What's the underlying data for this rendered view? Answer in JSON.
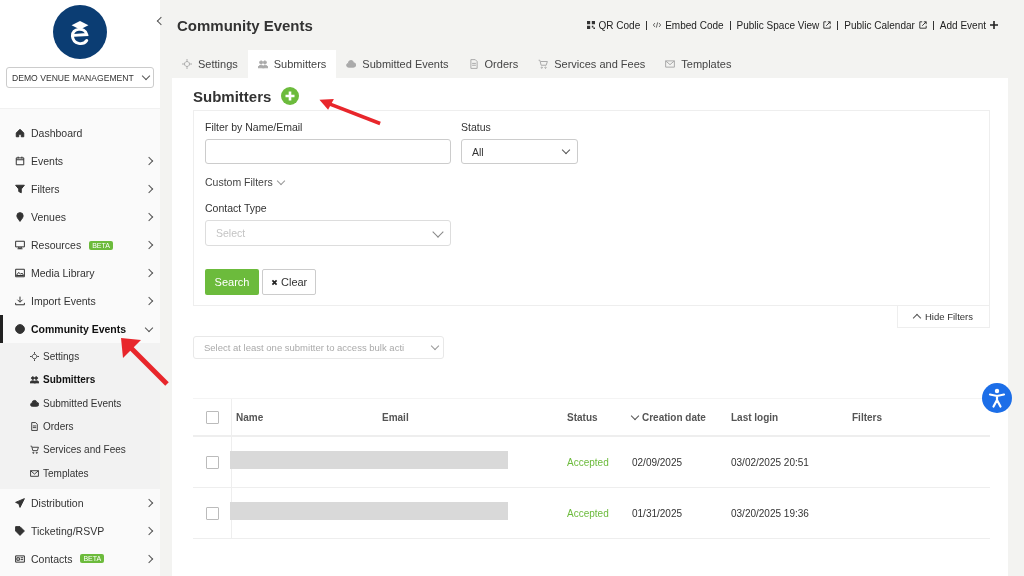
{
  "sidebar": {
    "venue_select": "DEMO VENUE MANAGEMENT",
    "items": [
      {
        "label": "Dashboard",
        "selected": false
      },
      {
        "label": "Events",
        "selected": false,
        "expanded": false
      },
      {
        "label": "Filters",
        "selected": false,
        "expanded": false
      },
      {
        "label": "Venues",
        "selected": false,
        "expanded": false
      },
      {
        "label": "Resources",
        "badge": "BETA",
        "selected": false,
        "expanded": false
      },
      {
        "label": "Media Library",
        "selected": false,
        "expanded": false
      },
      {
        "label": "Import Events",
        "selected": false,
        "expanded": false
      },
      {
        "label": "Community Events",
        "selected": true,
        "expanded": true,
        "children": [
          {
            "label": "Settings",
            "selected": false
          },
          {
            "label": "Submitters",
            "selected": true
          },
          {
            "label": "Submitted Events",
            "selected": false
          },
          {
            "label": "Orders",
            "selected": false
          },
          {
            "label": "Services and Fees",
            "selected": false
          },
          {
            "label": "Templates",
            "selected": false
          }
        ]
      },
      {
        "label": "Distribution",
        "selected": false,
        "expanded": false
      },
      {
        "label": "Ticketing/RSVP",
        "selected": false,
        "expanded": false
      },
      {
        "label": "Contacts",
        "badge": "BETA",
        "selected": false,
        "expanded": false
      }
    ]
  },
  "header": {
    "title": "Community Events",
    "links": [
      {
        "label": "QR Code",
        "kind": "qr"
      },
      {
        "label": "Embed Code",
        "kind": "code"
      },
      {
        "label": "Public Space View",
        "kind": "external"
      },
      {
        "label": "Public Calendar",
        "kind": "external"
      },
      {
        "label": "Add Event",
        "kind": "add"
      }
    ]
  },
  "tabs": [
    {
      "label": "Settings",
      "selected": false
    },
    {
      "label": "Submitters",
      "selected": true
    },
    {
      "label": "Submitted Events",
      "selected": false
    },
    {
      "label": "Orders",
      "selected": false
    },
    {
      "label": "Services and Fees",
      "selected": false
    },
    {
      "label": "Templates",
      "selected": false
    }
  ],
  "panel": {
    "title": "Submitters",
    "filters": {
      "name_label": "Filter by Name/Email",
      "status_label": "Status",
      "status_value": "All",
      "custom_filters": "Custom Filters",
      "contact_type_label": "Contact Type",
      "contact_type_placeholder": "Select",
      "search_button": "Search",
      "clear_button": "Clear",
      "hide_filters": "Hide Filters"
    },
    "bulk_action": "Select at least one submitter to access bulk acti",
    "table": {
      "select_all_checked": false,
      "columns": [
        {
          "label": "Name",
          "sorted": false
        },
        {
          "label": "Email",
          "sorted": false
        },
        {
          "label": "Status",
          "sorted": false
        },
        {
          "label": "Creation date",
          "sorted": true
        },
        {
          "label": "Last login",
          "sorted": false
        },
        {
          "label": "Filters",
          "sorted": false
        }
      ],
      "rows": [
        {
          "checked": false,
          "status": "Accepted",
          "creation_date": "02/09/2025",
          "last_login": "03/02/2025 20:51"
        },
        {
          "checked": false,
          "status": "Accepted",
          "creation_date": "01/31/2025",
          "last_login": "03/20/2025 19:36"
        }
      ]
    }
  }
}
